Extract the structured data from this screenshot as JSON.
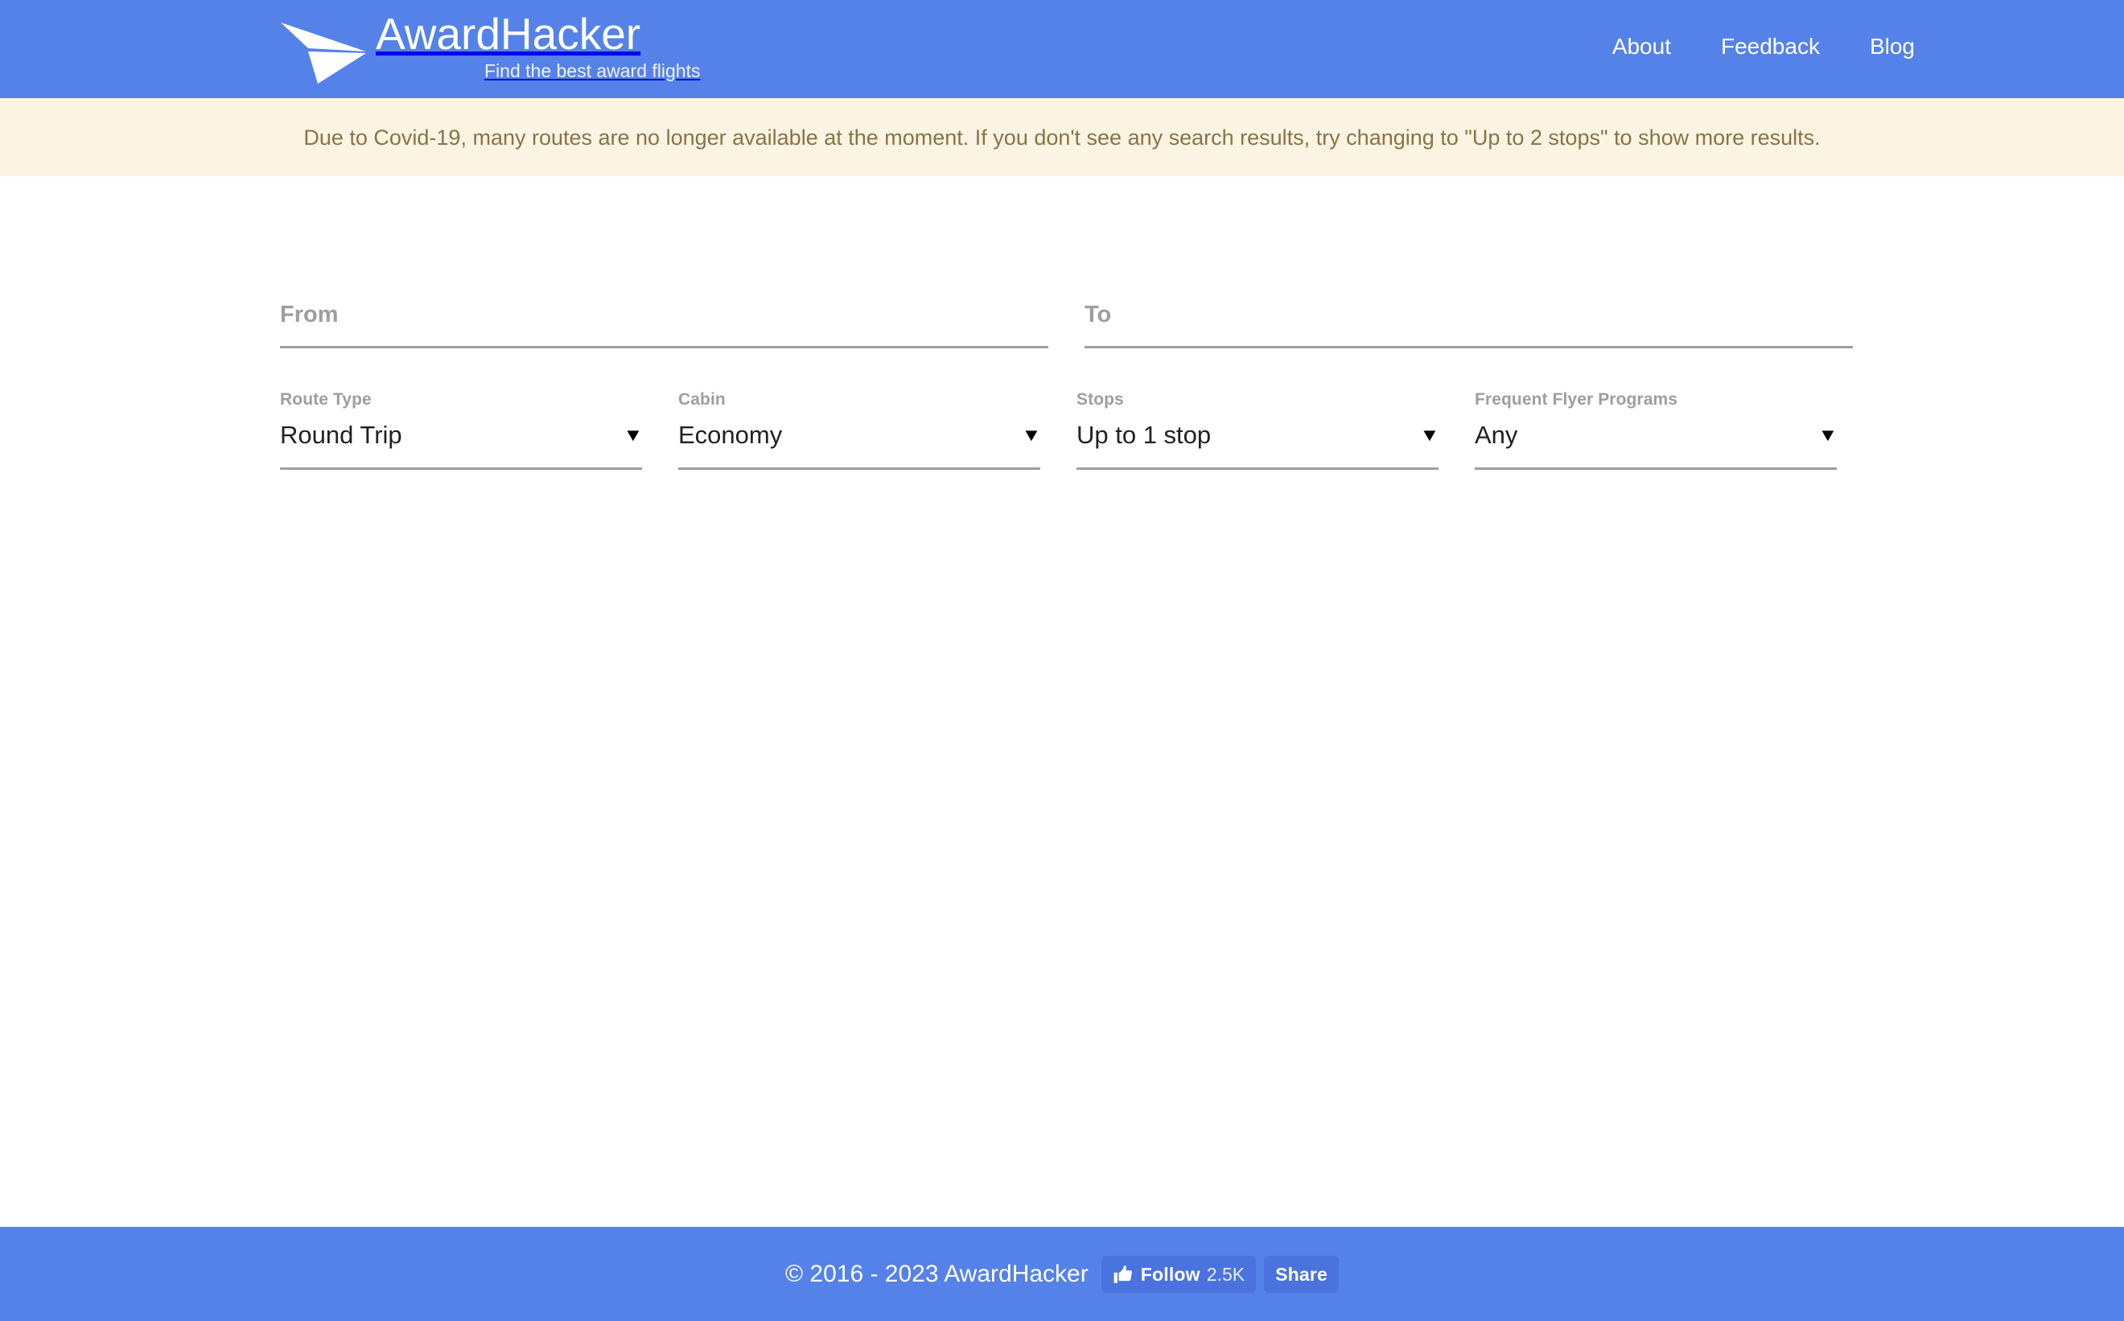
{
  "header": {
    "brand_title": "AwardHacker",
    "brand_tagline": "Find the best award flights",
    "logo_icon": "paper-plane-icon",
    "nav": [
      {
        "label": "About"
      },
      {
        "label": "Feedback"
      },
      {
        "label": "Blog"
      }
    ]
  },
  "banner": {
    "text": "Due to Covid-19, many routes are no longer available at the moment. If you don't see any search results, try changing to \"Up to 2 stops\" to show more results.",
    "background_color": "#FCF4E3",
    "text_color": "#8a7244"
  },
  "search_form": {
    "from": {
      "placeholder": "From",
      "value": ""
    },
    "to": {
      "placeholder": "To",
      "value": ""
    },
    "route_type": {
      "label": "Route Type",
      "value": "Round Trip"
    },
    "cabin": {
      "label": "Cabin",
      "value": "Economy"
    },
    "stops": {
      "label": "Stops",
      "value": "Up to 1 stop"
    },
    "frequent_flyer_programs": {
      "label": "Frequent Flyer Programs",
      "value": "Any"
    },
    "caret_glyph": "▼"
  },
  "footer": {
    "copyright": "© 2016 - 2023 AwardHacker",
    "follow_label": "Follow",
    "follow_count": "2.5K",
    "share_label": "Share",
    "thumb_icon": "thumbs-up-icon"
  },
  "theme": {
    "brand_blue": "#5582E8",
    "banner_cream": "#FCF4E3",
    "label_grey": "#9e9e9e",
    "value_dark": "#212121"
  }
}
